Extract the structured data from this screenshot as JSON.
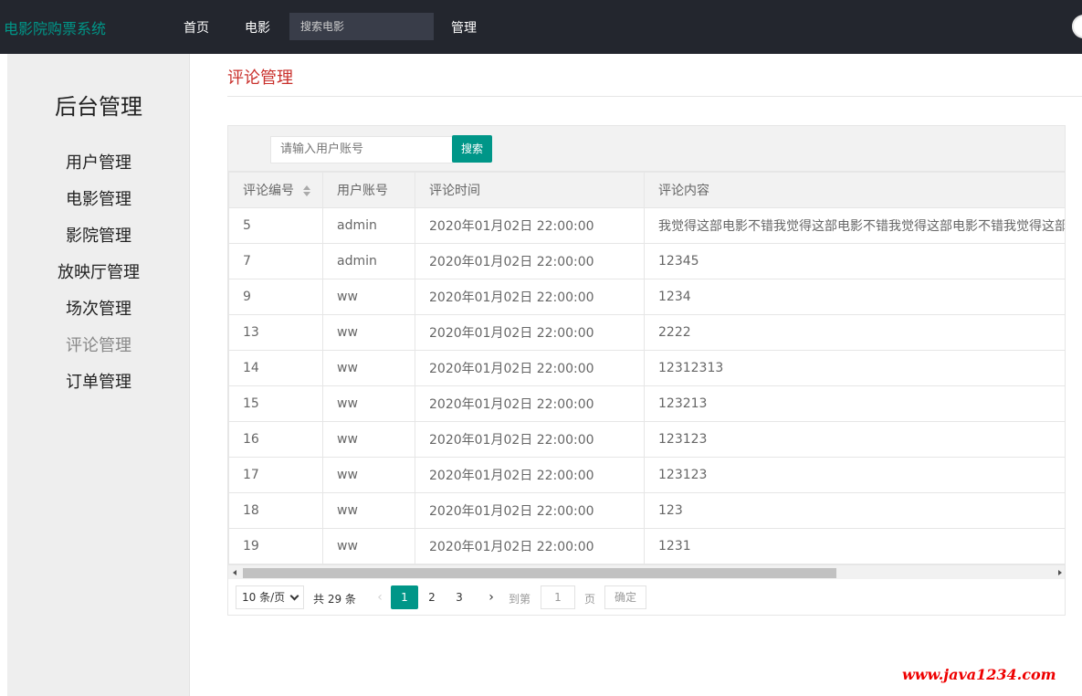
{
  "app": {
    "brand": "电影院购票系统"
  },
  "topnav": {
    "home": "首页",
    "movies": "电影",
    "search_placeholder": "搜索电影",
    "admin": "管理"
  },
  "sidebar": {
    "title": "后台管理",
    "items": [
      {
        "label": "用户管理"
      },
      {
        "label": "电影管理"
      },
      {
        "label": "影院管理"
      },
      {
        "label": "放映厅管理"
      },
      {
        "label": "场次管理"
      },
      {
        "label": "评论管理"
      },
      {
        "label": "订单管理"
      }
    ],
    "active_index": 5
  },
  "main": {
    "title": "评论管理",
    "search": {
      "placeholder": "请输入用户账号",
      "button": "搜索"
    },
    "table": {
      "columns": [
        "评论编号",
        "用户账号",
        "评论时间",
        "评论内容"
      ],
      "rows": [
        [
          "5",
          "admin",
          "2020年01月02日 22:00:00",
          "我觉得这部电影不错我觉得这部电影不错我觉得这部电影不错我觉得这部电影不错"
        ],
        [
          "7",
          "admin",
          "2020年01月02日 22:00:00",
          "12345"
        ],
        [
          "9",
          "ww",
          "2020年01月02日 22:00:00",
          "1234"
        ],
        [
          "13",
          "ww",
          "2020年01月02日 22:00:00",
          "2222"
        ],
        [
          "14",
          "ww",
          "2020年01月02日 22:00:00",
          "12312313"
        ],
        [
          "15",
          "ww",
          "2020年01月02日 22:00:00",
          "123213"
        ],
        [
          "16",
          "ww",
          "2020年01月02日 22:00:00",
          "123123"
        ],
        [
          "17",
          "ww",
          "2020年01月02日 22:00:00",
          "123123"
        ],
        [
          "18",
          "ww",
          "2020年01月02日 22:00:00",
          "123"
        ],
        [
          "19",
          "ww",
          "2020年01月02日 22:00:00",
          "1231"
        ]
      ]
    },
    "pager": {
      "page_size": "10 条/页",
      "total": "共 29 条",
      "prev": "‹",
      "pages": [
        "1",
        "2",
        "3"
      ],
      "current": "1",
      "next": "›",
      "goto_label": "到第",
      "goto_value": "1",
      "page_label": "页",
      "confirm": "确定"
    }
  },
  "watermark": "www.java1234.com",
  "colors": {
    "accent": "#009688",
    "topbar": "#23262e",
    "title": "#c9302c",
    "watermark": "#ee0000"
  }
}
